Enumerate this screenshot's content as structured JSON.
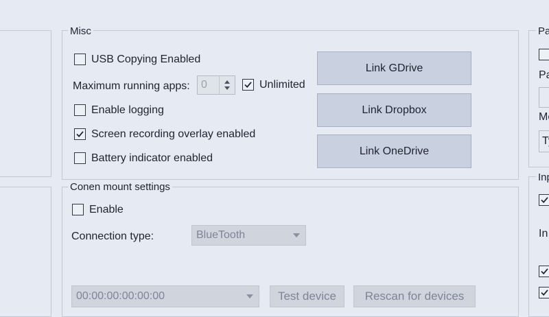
{
  "misc": {
    "title": "Misc",
    "usb_copying_label": "USB Copying Enabled",
    "usb_copying_checked": false,
    "max_running_apps_label": "Maximum running apps:",
    "max_running_apps_value": "0",
    "unlimited_label": "Unlimited",
    "unlimited_checked": true,
    "enable_logging_label": "Enable logging",
    "enable_logging_checked": false,
    "screen_overlay_label": "Screen recording overlay enabled",
    "screen_overlay_checked": true,
    "battery_indicator_label": "Battery indicator enabled",
    "battery_indicator_checked": false,
    "link_gdrive_label": "Link GDrive",
    "link_dropbox_label": "Link Dropbox",
    "link_onedrive_label": "Link OneDrive"
  },
  "conen": {
    "title": "Conen mount settings",
    "enable_label": "Enable",
    "enable_checked": false,
    "connection_type_label": "Connection type:",
    "connection_type_value": "BlueTooth",
    "device_address_value": "00:00:00:00:00:00",
    "test_device_label": "Test device",
    "rescan_label": "Rescan for devices"
  },
  "right_panel": {
    "partial_label_1": "Pa",
    "partial_label_2": "Pa",
    "partial_label_3": "Me",
    "partial_field_text": "Ty",
    "partial_group_title": "Inp",
    "partial_label_4": "In"
  },
  "colors": {
    "background": "#e6eaf2",
    "button": "#c9d1e0",
    "disabled": "#cfd4dd"
  }
}
